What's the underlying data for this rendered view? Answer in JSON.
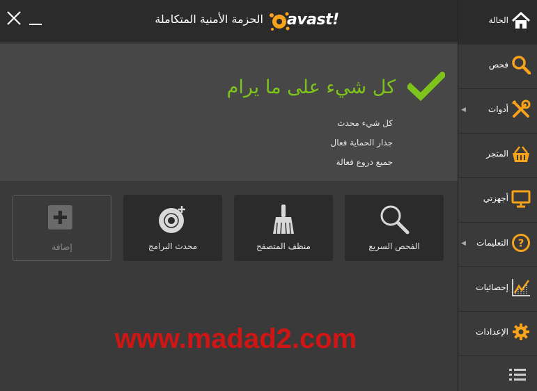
{
  "header": {
    "title": "الحزمة الأمنية المتكاملة",
    "brand": "avast!"
  },
  "status": {
    "heading": "كل شيء على ما يرام",
    "lines": [
      "كل شيء محدث",
      "جدار الحماية فعال",
      "جميع دروع فعالة"
    ],
    "accent": "#7fc41d"
  },
  "tiles": [
    {
      "label": "الفحص السريع",
      "icon": "magnifier-icon"
    },
    {
      "label": "منظف المتصفح",
      "icon": "broom-icon"
    },
    {
      "label": "محدث البرامج",
      "icon": "disc-icon"
    },
    {
      "label": "إضافة",
      "icon": "plus-icon"
    }
  ],
  "watermark": "www.madad2.com",
  "sidebar": {
    "items": [
      {
        "label": "الحالة",
        "icon": "home-icon"
      },
      {
        "label": "فحص",
        "icon": "search-icon"
      },
      {
        "label": "أدوات",
        "icon": "tools-icon"
      },
      {
        "label": "المتجر",
        "icon": "basket-icon"
      },
      {
        "label": "أجهزتي",
        "icon": "monitor-icon"
      },
      {
        "label": "التعليمات",
        "icon": "help-icon"
      },
      {
        "label": "إحصائيات",
        "icon": "stats-icon"
      },
      {
        "label": "الإعدادات",
        "icon": "gear-icon"
      }
    ],
    "accent": "#f7a21b"
  }
}
